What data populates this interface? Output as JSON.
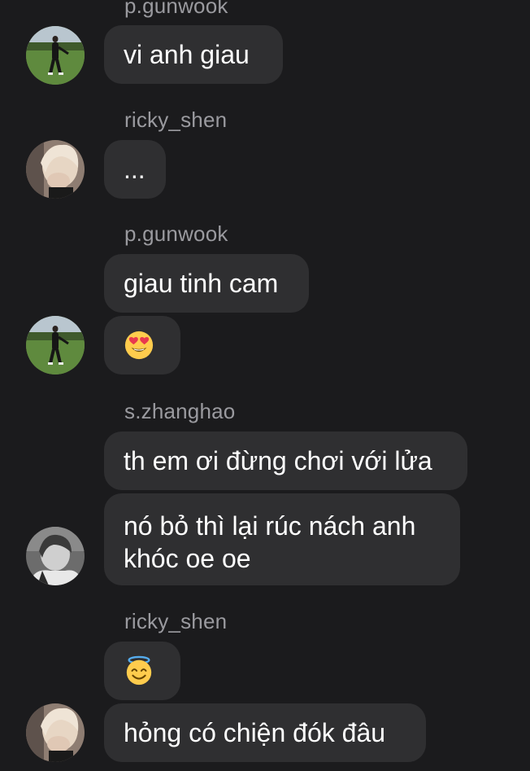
{
  "messages": [
    {
      "sender": "p.gunwook",
      "text": "vi anh giau"
    },
    {
      "sender": "ricky_shen",
      "text": "..."
    },
    {
      "sender": "p.gunwook",
      "text": "giau tinh cam"
    },
    {
      "emoji": "heart-eyes-emoji"
    },
    {
      "sender": "s.zhanghao",
      "text": "th em ơi đừng chơi với lửa"
    },
    {
      "text": "nó bỏ thì lại rúc nách anh khóc oe oe"
    },
    {
      "sender": "ricky_shen",
      "emoji": "halo-smile-emoji"
    },
    {
      "text": "hỏng có chiện đók đâu"
    }
  ],
  "colors": {
    "background": "#1b1b1d",
    "bubble": "#2f2f31",
    "sender_text": "#9a9a9f",
    "message_text": "#ffffff"
  }
}
